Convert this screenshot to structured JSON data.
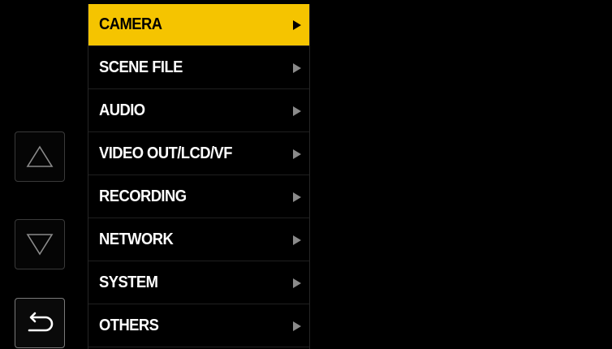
{
  "menu": {
    "items": [
      {
        "label": "CAMERA",
        "selected": true
      },
      {
        "label": "SCENE FILE",
        "selected": false
      },
      {
        "label": "AUDIO",
        "selected": false
      },
      {
        "label": "VIDEO OUT/LCD/VF",
        "selected": false
      },
      {
        "label": "RECORDING",
        "selected": false
      },
      {
        "label": "NETWORK",
        "selected": false
      },
      {
        "label": "SYSTEM",
        "selected": false
      },
      {
        "label": "OTHERS",
        "selected": false
      }
    ]
  },
  "colors": {
    "background": "#000000",
    "selected_highlight": "#f5c400",
    "text": "#ffffff",
    "arrow": "#8a8a8a"
  },
  "icons": [
    "up-triangle-icon",
    "down-triangle-icon",
    "return-icon",
    "submenu-arrow-icon"
  ]
}
